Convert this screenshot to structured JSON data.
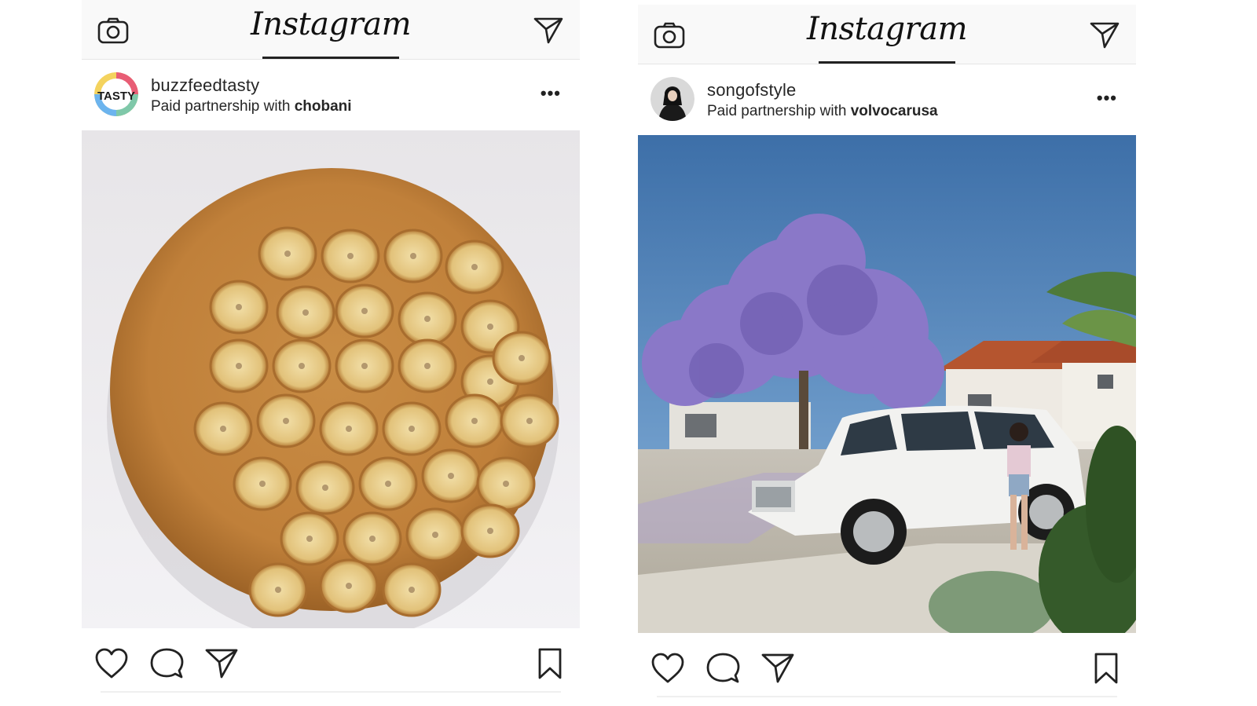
{
  "left_post": {
    "app_title": "Instagram",
    "avatar_text": "TASTY",
    "username": "buzzfeedtasty",
    "partnership_prefix": "Paid partnership with",
    "partner": "chobani",
    "more": "•••",
    "icons": [
      "camera-icon",
      "direct-send-icon",
      "heart-icon",
      "comment-icon",
      "share-icon",
      "bookmark-icon"
    ]
  },
  "right_post": {
    "app_title": "Instagram",
    "username": "songofstyle",
    "partnership_prefix": "Paid partnership with",
    "partner": "volvocarusa",
    "more": "•••",
    "icons": [
      "camera-icon",
      "direct-send-icon",
      "heart-icon",
      "comment-icon",
      "share-icon",
      "bookmark-icon"
    ]
  }
}
